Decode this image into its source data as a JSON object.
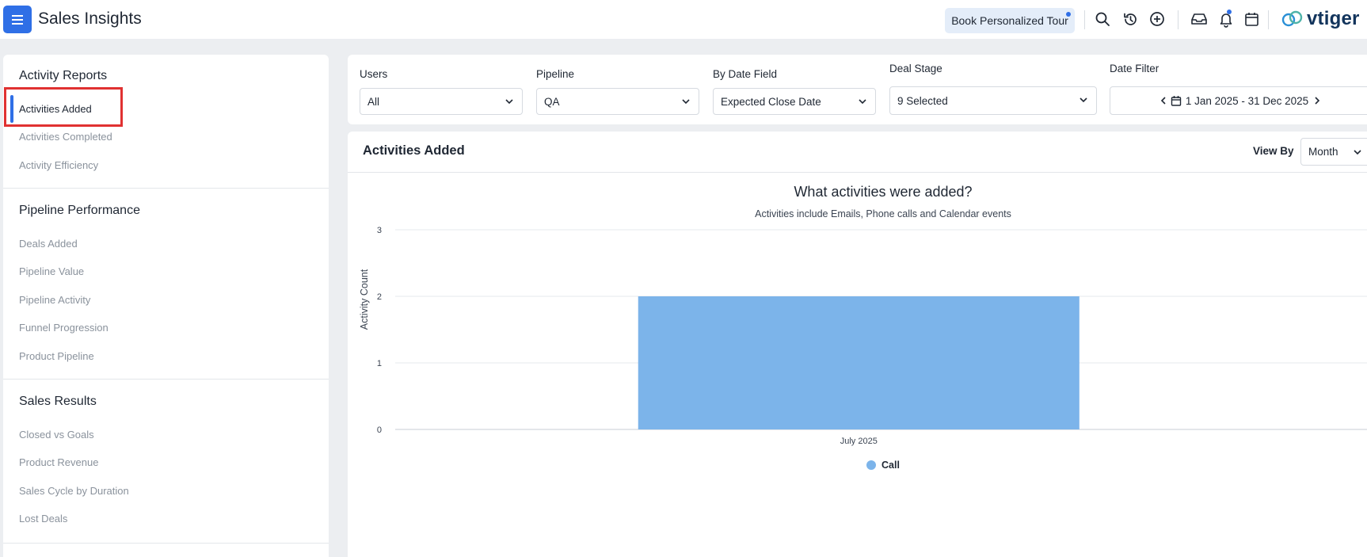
{
  "app": {
    "title": "Sales Insights"
  },
  "header": {
    "tour_label": "Book Personalized Tour",
    "brand": "vtiger",
    "icons": [
      "menu-icon",
      "search-icon",
      "history-icon",
      "add-circle-icon",
      "inbox-icon",
      "bell-icon",
      "calendar-icon"
    ]
  },
  "sidebar": {
    "sections": [
      {
        "title": "Activity Reports",
        "items": [
          "Activities Added",
          "Activities Completed",
          "Activity Efficiency"
        ]
      },
      {
        "title": "Pipeline Performance",
        "items": [
          "Deals Added",
          "Pipeline Value",
          "Pipeline Activity",
          "Funnel Progression",
          "Product Pipeline"
        ]
      },
      {
        "title": "Sales Results",
        "items": [
          "Closed vs Goals",
          "Product Revenue",
          "Sales Cycle by Duration",
          "Lost Deals"
        ]
      }
    ],
    "active_item": "Activities Added"
  },
  "filters": {
    "users": {
      "label": "Users",
      "value": "All"
    },
    "pipeline": {
      "label": "Pipeline",
      "value": "QA"
    },
    "date_field": {
      "label": "By Date Field",
      "value": "Expected Close Date"
    },
    "deal_stage": {
      "label": "Deal Stage",
      "value": "9 Selected"
    },
    "date_filter": {
      "label": "Date Filter",
      "value": "1 Jan 2025 - 31 Dec 2025"
    }
  },
  "report": {
    "title": "Activities Added",
    "view_by_label": "View By",
    "view_by_value": "Month"
  },
  "colors": {
    "accent": "#2f6fe6",
    "bar": "#7cb4ea",
    "highlight": "#e03131"
  },
  "chart_data": {
    "type": "bar",
    "title": "What activities were added?",
    "subtitle": "Activities include Emails, Phone calls and Calendar events",
    "ylabel": "Activity Count",
    "xlabel": "",
    "categories": [
      "July 2025"
    ],
    "series": [
      {
        "name": "Call",
        "values": [
          2
        ],
        "color": "#7cb4ea"
      }
    ],
    "yticks": [
      "0",
      "1",
      "2",
      "3"
    ],
    "ylim": [
      0,
      3
    ],
    "grid": true,
    "legend": "bottom-center"
  }
}
